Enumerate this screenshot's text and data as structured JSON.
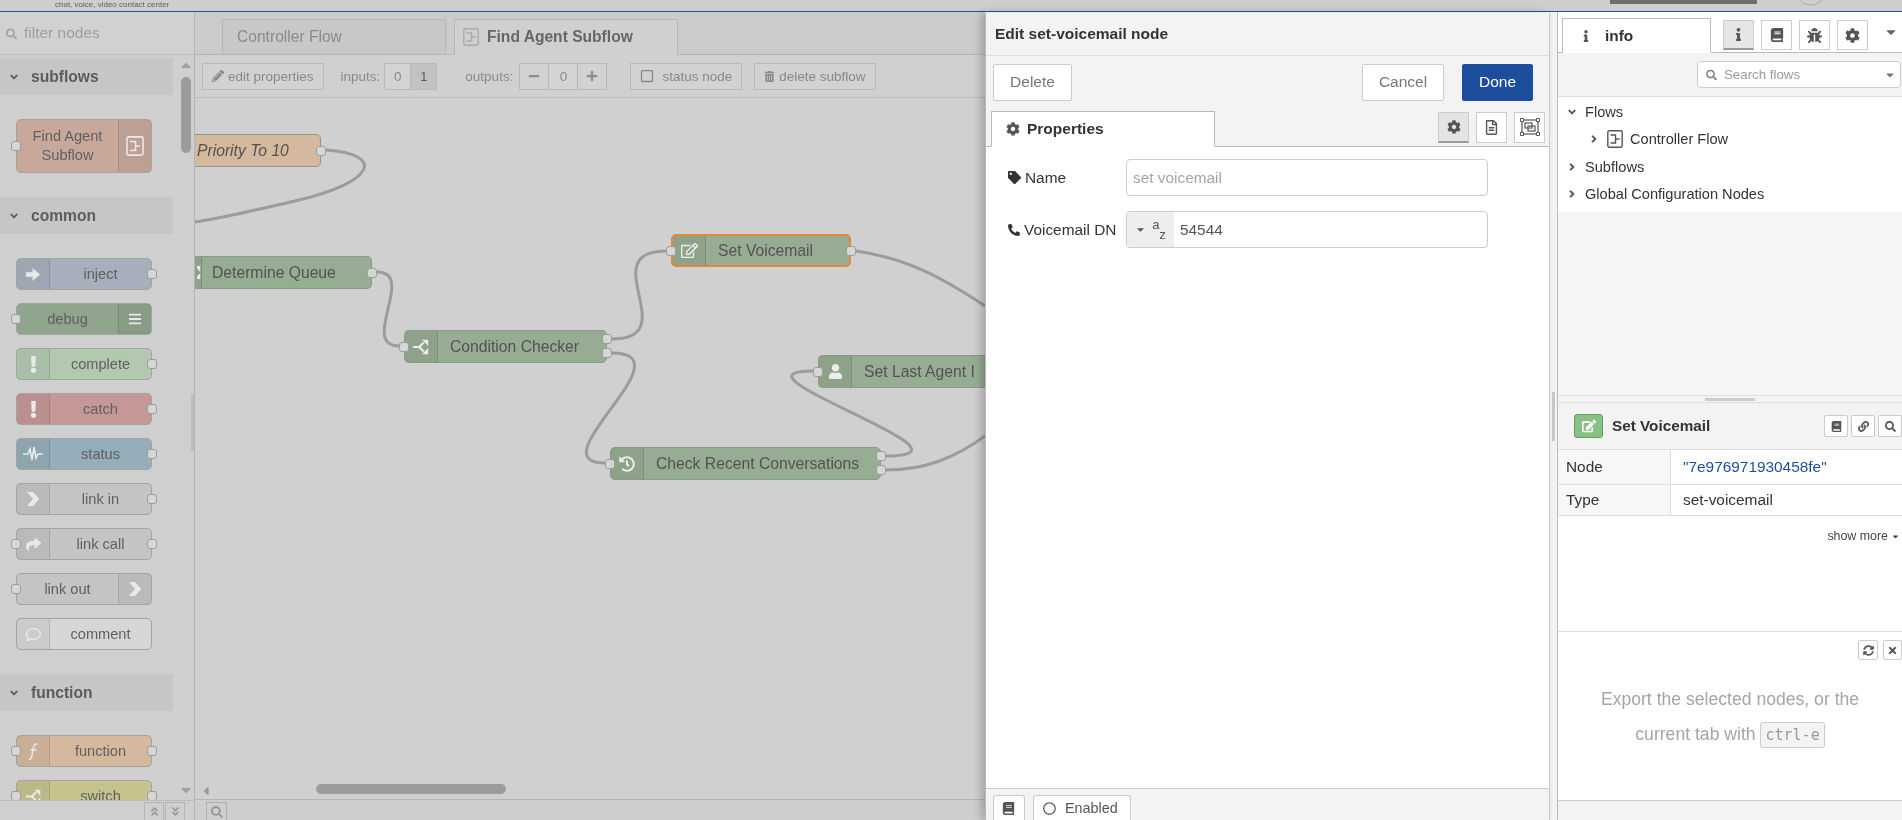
{
  "header": {
    "tagline": "chat, voice, video contact center"
  },
  "palette": {
    "filter": {
      "placeholder": "filter nodes"
    },
    "categories": [
      {
        "name": "subflows",
        "expanded": true,
        "nodes": [
          {
            "label": "Find Agent Subflow",
            "kind": "subflow",
            "color": "#c9a89c"
          }
        ]
      },
      {
        "name": "common",
        "expanded": true,
        "nodes": [
          {
            "label": "inject",
            "kind": "inject",
            "color": "#a6afbb"
          },
          {
            "label": "debug",
            "kind": "debug",
            "color": "#8fa58c"
          },
          {
            "label": "complete",
            "kind": "complete",
            "color": "#b3c9af"
          },
          {
            "label": "catch",
            "kind": "catch",
            "color": "#c69797"
          },
          {
            "label": "status",
            "kind": "status",
            "color": "#95aeb9"
          },
          {
            "label": "link in",
            "kind": "linkin",
            "color": "#c4c4c4"
          },
          {
            "label": "link call",
            "kind": "linkcall",
            "color": "#c4c4c4"
          },
          {
            "label": "link out",
            "kind": "linkout",
            "color": "#c4c4c4"
          },
          {
            "label": "comment",
            "kind": "comment",
            "color": "#d6d6d6"
          }
        ]
      },
      {
        "name": "function",
        "expanded": true,
        "nodes": [
          {
            "label": "function",
            "kind": "function",
            "color": "#d4b99e"
          },
          {
            "label": "switch",
            "kind": "switch",
            "color": "#c7c38f"
          }
        ]
      }
    ]
  },
  "workspace": {
    "tabs": [
      {
        "label": "Controller Flow",
        "kind": "flow",
        "selected": false
      },
      {
        "label": "Find Agent Subflow",
        "kind": "subflow",
        "selected": true
      }
    ],
    "toolbar": {
      "edit_properties": "edit properties",
      "inputs_label": "inputs:",
      "inputs": [
        {
          "label": "0",
          "selected": false
        },
        {
          "label": "1",
          "selected": true
        }
      ],
      "outputs_label": "outputs:",
      "outputs_value": "0",
      "status_node": {
        "label": "status node",
        "checked": false
      },
      "delete_subflow": "delete subflow"
    },
    "nodes": [
      {
        "label": "Priority To 10",
        "color": "#d5b99f",
        "italic": true,
        "selected": false
      },
      {
        "label": "Determine Queue",
        "kind": "switch",
        "color": "#97ad93",
        "italic": false,
        "selected": false
      },
      {
        "label": "Condition Checker",
        "kind": "switch",
        "color": "#97ad93",
        "italic": false,
        "selected": false
      },
      {
        "label": "Set Voicemail",
        "kind": "voicemail",
        "color": "#97ad93",
        "italic": false,
        "selected": true
      },
      {
        "label": "Set Last Agent I",
        "kind": "agent",
        "color": "#97ad93",
        "italic": false,
        "selected": false
      },
      {
        "label": "Check Recent Conversations",
        "kind": "history",
        "color": "#97ad93",
        "italic": false,
        "selected": false
      }
    ]
  },
  "edit_dialog": {
    "title": "Edit set-voicemail node",
    "buttons": {
      "delete": "Delete",
      "cancel": "Cancel",
      "done": "Done"
    },
    "tabs": [
      {
        "label": "Properties",
        "selected": true
      }
    ],
    "views": [
      {
        "kind": "properties",
        "selected": true
      },
      {
        "kind": "description",
        "selected": false
      },
      {
        "kind": "appearance",
        "selected": false
      }
    ],
    "fields": [
      {
        "kind": "text",
        "label": "Name",
        "placeholder": "set voicemail"
      },
      {
        "kind": "typed",
        "label": "Voicemail DN",
        "type_label": "$^{a}$$_{z}$",
        "value": "54544"
      }
    ],
    "footer": {
      "enabled": "Enabled"
    }
  },
  "sidebar": {
    "tabs": [
      {
        "label": "info",
        "selected": true
      }
    ],
    "tools": [
      {
        "kind": "info",
        "selected": true
      },
      {
        "kind": "help",
        "selected": false
      },
      {
        "kind": "debug",
        "selected": false
      },
      {
        "kind": "config",
        "selected": false
      }
    ],
    "search": {
      "placeholder": "Search flows"
    },
    "tree": [
      {
        "label": "Flows",
        "expanded": true,
        "children": [
          {
            "label": "Controller Flow",
            "expanded": false
          }
        ]
      },
      {
        "label": "Subflows",
        "expanded": false
      },
      {
        "label": "Global Configuration Nodes",
        "expanded": false
      }
    ],
    "info": {
      "title": "Set Voicemail",
      "properties": [
        {
          "key": "Node",
          "value": "\"7e976971930458fe\"",
          "kind": "string"
        },
        {
          "key": "Type",
          "value": "set-voicemail",
          "kind": "plain"
        }
      ],
      "show_more": "show more"
    },
    "export_hint": {
      "text": "Export the selected nodes, or the current tab with",
      "shortcut": "ctrl-e"
    }
  }
}
